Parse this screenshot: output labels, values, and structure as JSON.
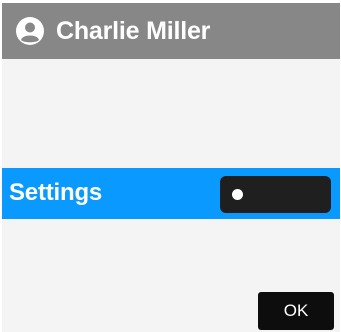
{
  "header": {
    "icon": "user-avatar-icon",
    "title": "Charlie Miller",
    "background": "#878787"
  },
  "settings_row": {
    "label": "Settings",
    "background": "#0a99ff",
    "toggle": {
      "state": "off",
      "background": "#1f1f1f",
      "knob_color": "#ffffff"
    }
  },
  "footer": {
    "ok_label": "OK"
  },
  "colors": {
    "screen_background": "#f4f4f4",
    "text": "#ffffff",
    "button": "#0d0d0d"
  }
}
